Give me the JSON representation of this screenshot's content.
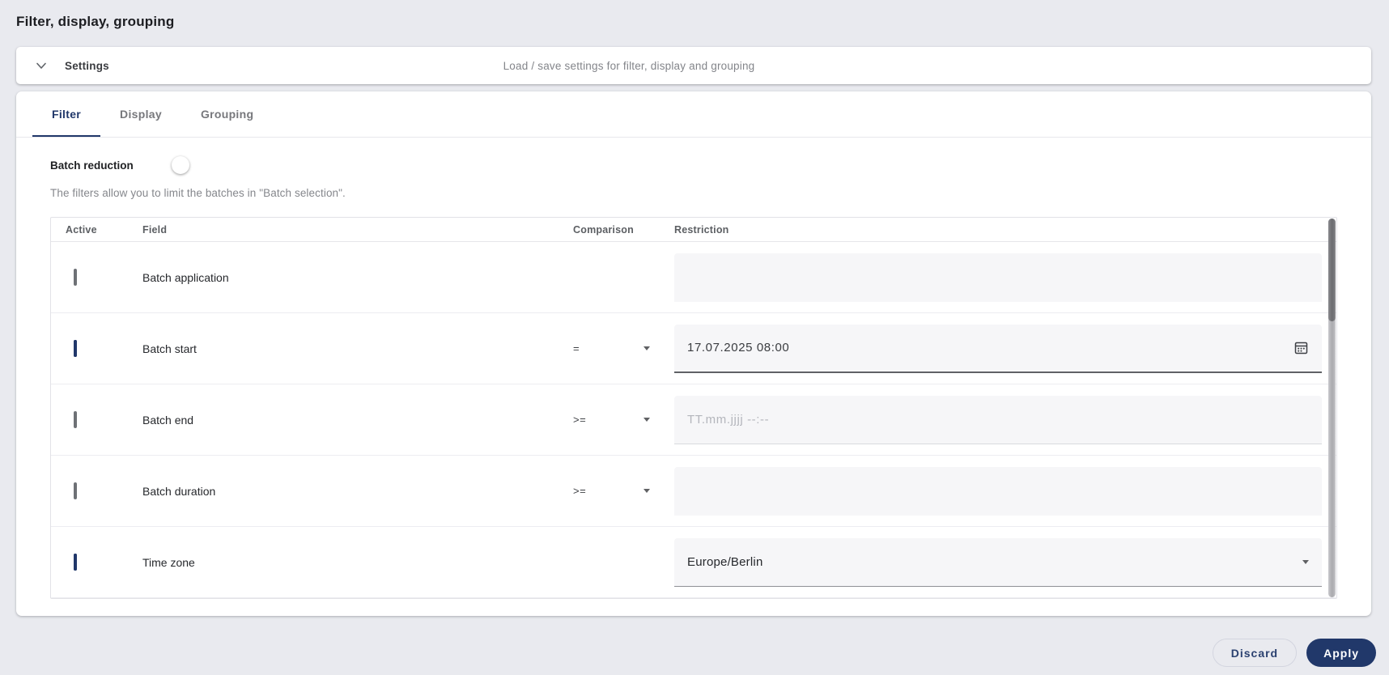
{
  "window": {
    "title": "Filter, display, grouping"
  },
  "settings_panel": {
    "title": "Settings",
    "description": "Load / save settings for filter, display and grouping"
  },
  "tabs": [
    {
      "label": "Filter",
      "active": true
    },
    {
      "label": "Display",
      "active": false
    },
    {
      "label": "Grouping",
      "active": false
    }
  ],
  "filter": {
    "batch_reduction_label": "Batch reduction",
    "batch_reduction_on": true,
    "hint": "The filters allow you to limit the batches in \"Batch selection\".",
    "table": {
      "columns": [
        "Active",
        "Field",
        "Comparison",
        "Restriction"
      ],
      "rows": [
        {
          "active": false,
          "field": "Batch application",
          "comparison": "",
          "restriction": ""
        },
        {
          "active": true,
          "field": "Batch start",
          "comparison": "=",
          "restriction": "17.07.2025 08:00"
        },
        {
          "active": false,
          "field": "Batch end",
          "comparison": ">=",
          "restriction": "",
          "placeholder": "TT.mm.jjjj --:--"
        },
        {
          "active": false,
          "field": "Batch duration",
          "comparison": ">=",
          "restriction": ""
        },
        {
          "active": true,
          "field": "Time zone",
          "comparison": "",
          "restriction": "Europe/Berlin"
        }
      ]
    }
  },
  "footer": {
    "discard": "Discard",
    "apply": "Apply"
  },
  "colors": {
    "accent": "#21386a",
    "toggle": "#3fa0f2",
    "page_bg": "#e9eaef"
  }
}
